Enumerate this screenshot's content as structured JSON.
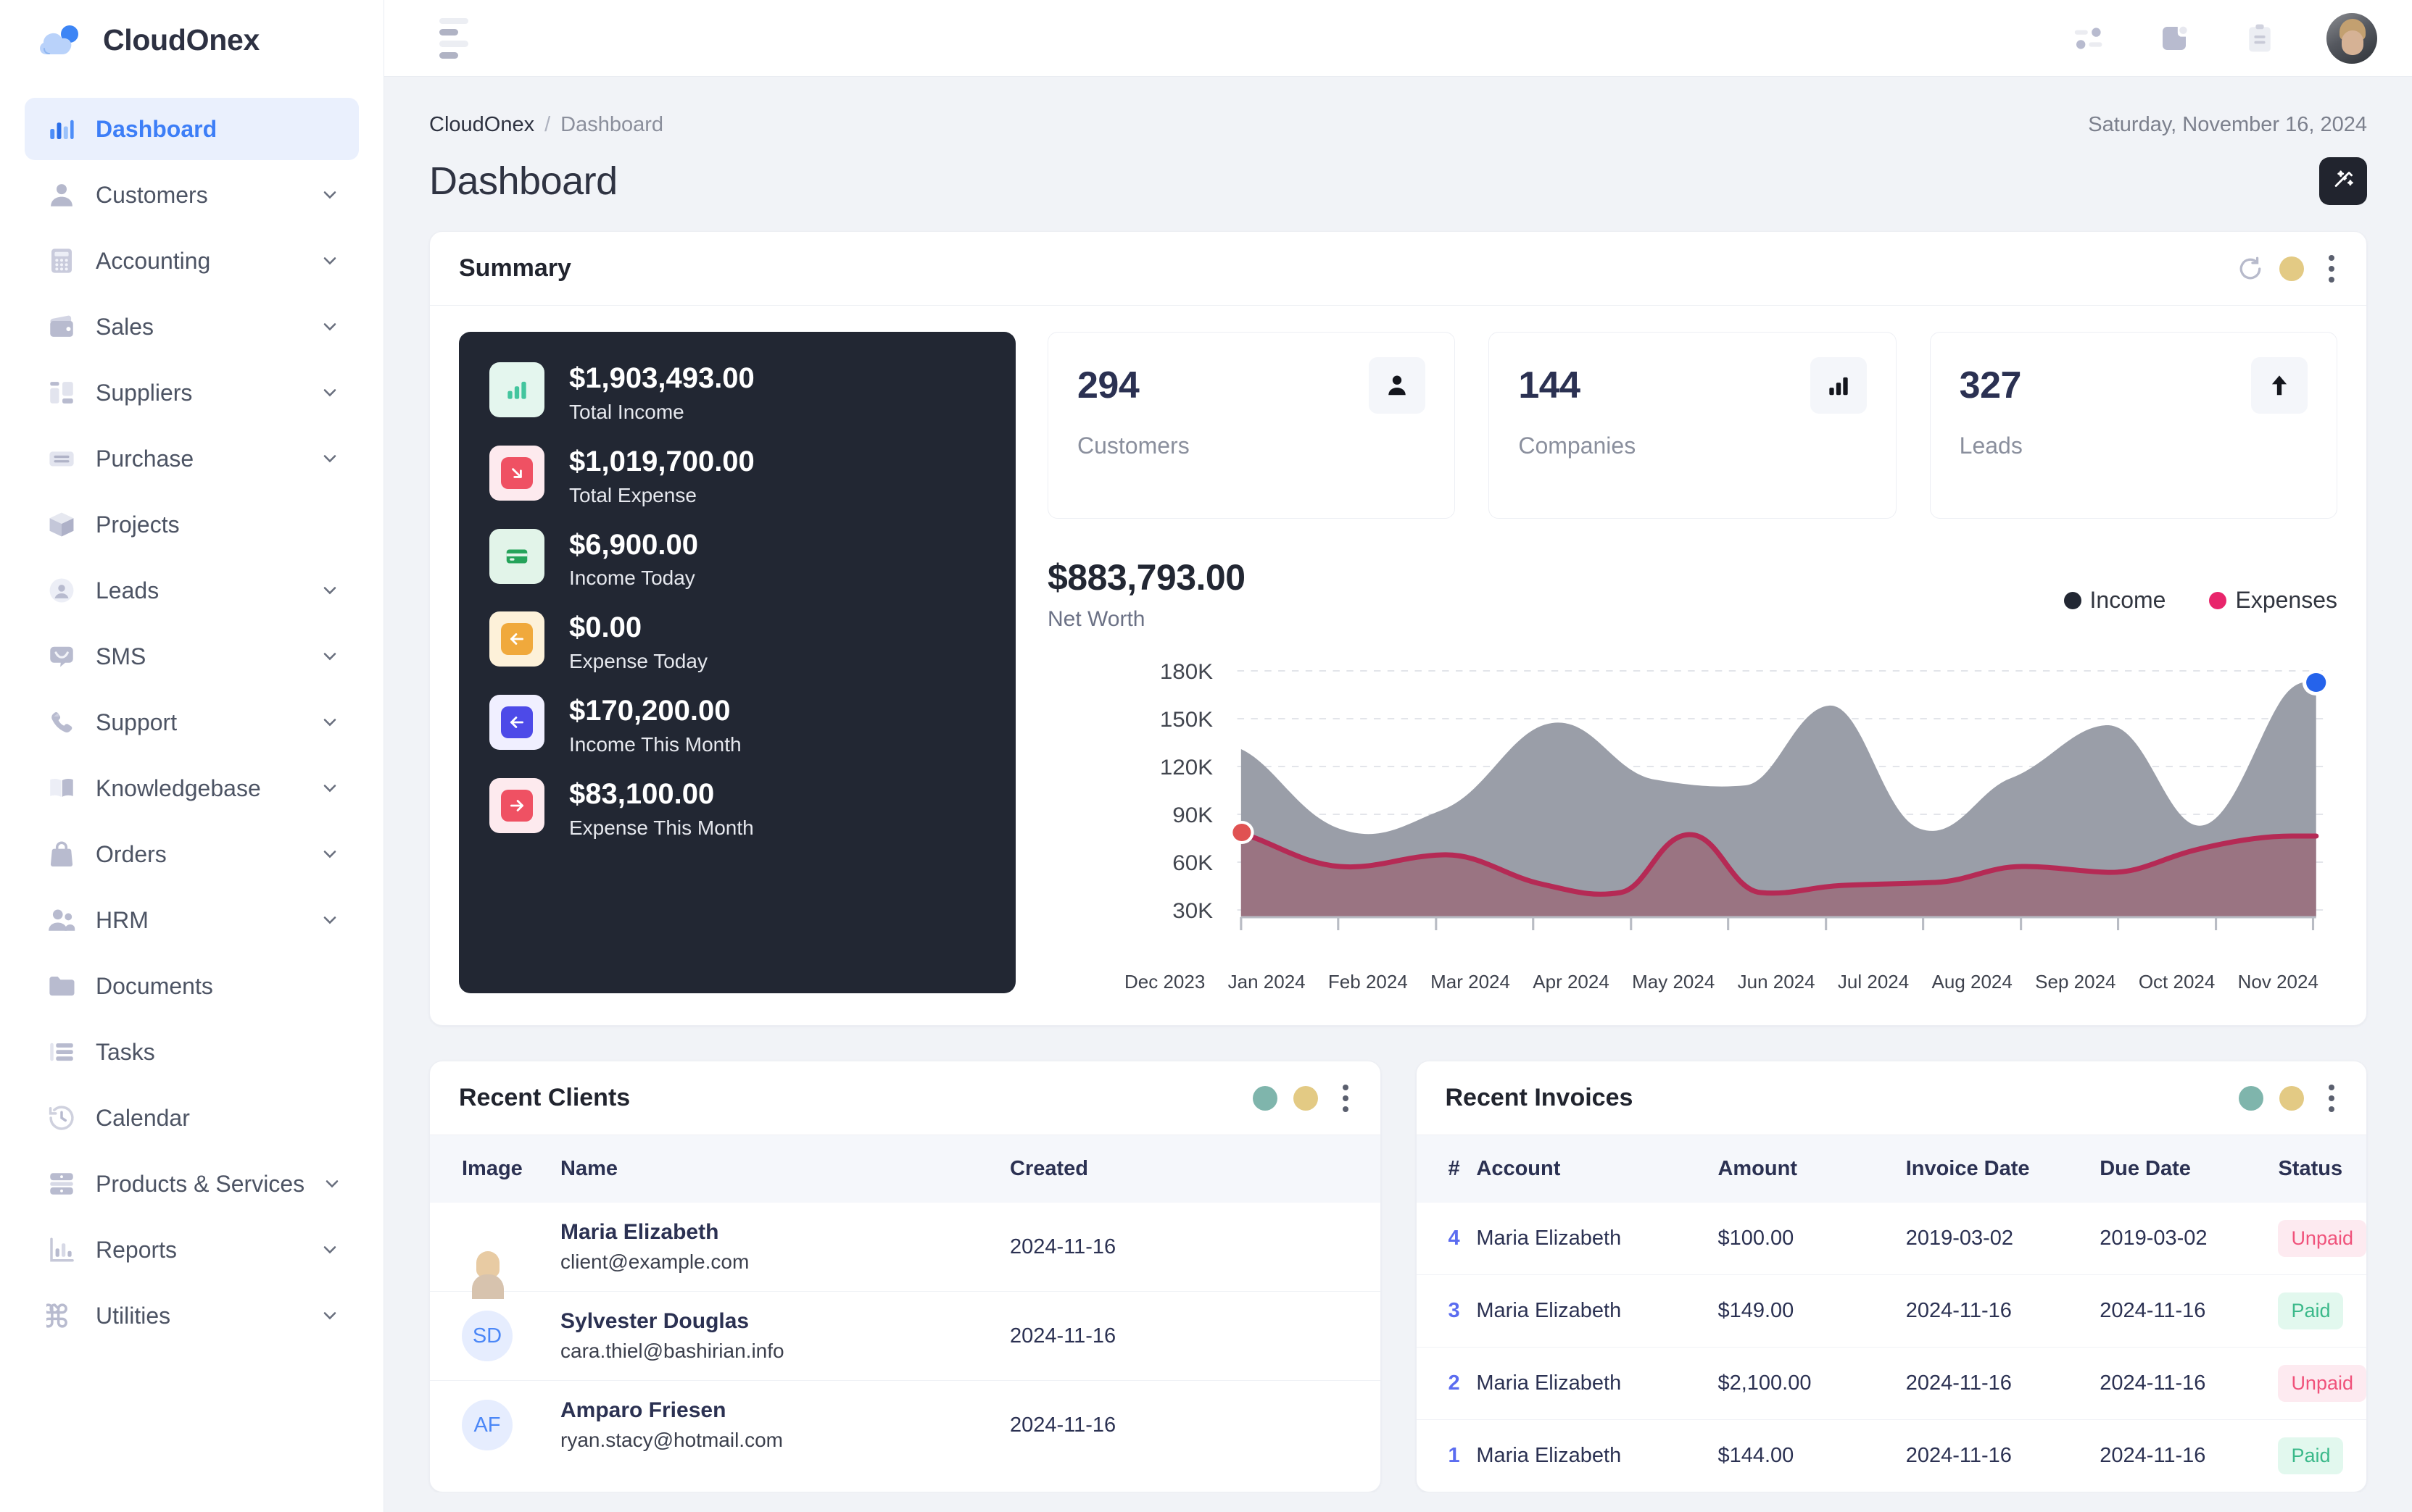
{
  "brand": {
    "name": "CloudOnex"
  },
  "sidebar": {
    "items": [
      {
        "label": "Dashboard",
        "icon": "bar-chart-icon",
        "active": true,
        "caret": false
      },
      {
        "label": "Customers",
        "icon": "user-icon",
        "active": false,
        "caret": true
      },
      {
        "label": "Accounting",
        "icon": "calculator-icon",
        "active": false,
        "caret": true
      },
      {
        "label": "Sales",
        "icon": "wallet-icon",
        "active": false,
        "caret": true
      },
      {
        "label": "Suppliers",
        "icon": "layout-icon",
        "active": false,
        "caret": true
      },
      {
        "label": "Purchase",
        "icon": "inbox-icon",
        "active": false,
        "caret": true
      },
      {
        "label": "Projects",
        "icon": "box-icon",
        "active": false,
        "caret": false
      },
      {
        "label": "Leads",
        "icon": "user-circle-icon",
        "active": false,
        "caret": true
      },
      {
        "label": "SMS",
        "icon": "message-icon",
        "active": false,
        "caret": true
      },
      {
        "label": "Support",
        "icon": "phone-icon",
        "active": false,
        "caret": true
      },
      {
        "label": "Knowledgebase",
        "icon": "book-icon",
        "active": false,
        "caret": true
      },
      {
        "label": "Orders",
        "icon": "bag-icon",
        "active": false,
        "caret": true
      },
      {
        "label": "HRM",
        "icon": "users-icon",
        "active": false,
        "caret": true
      },
      {
        "label": "Documents",
        "icon": "folder-icon",
        "active": false,
        "caret": false
      },
      {
        "label": "Tasks",
        "icon": "list-icon",
        "active": false,
        "caret": false
      },
      {
        "label": "Calendar",
        "icon": "clock-history-icon",
        "active": false,
        "caret": false
      },
      {
        "label": "Products & Services",
        "icon": "server-icon",
        "active": false,
        "caret": true
      },
      {
        "label": "Reports",
        "icon": "chart-bar-icon",
        "active": false,
        "caret": true
      },
      {
        "label": "Utilities",
        "icon": "command-icon",
        "active": false,
        "caret": true
      }
    ]
  },
  "topbar": {
    "menu_toggle": "hamburger-icon",
    "icons": [
      "sliders-icon",
      "note-icon",
      "clipboard-icon"
    ],
    "avatar": "user-avatar"
  },
  "breadcrumb": {
    "root": "CloudOnex",
    "separator": "/",
    "current": "Dashboard"
  },
  "header": {
    "title": "Dashboard",
    "date": "Saturday, November 16, 2024",
    "action_icon": "magic-wand-icon"
  },
  "summary": {
    "title": "Summary",
    "finance": [
      {
        "value": "$1,903,493.00",
        "label": "Total Income",
        "icon": "bar-chart-icon",
        "bg": "#e4f6ee",
        "fg": "#43c59e"
      },
      {
        "value": "$1,019,700.00",
        "label": "Total Expense",
        "icon": "arrow-down-right-icon",
        "bg": "#fdeaee",
        "fg": "#ef5163"
      },
      {
        "value": "$6,900.00",
        "label": "Income Today",
        "icon": "card-icon",
        "bg": "#e2f4e9",
        "fg": "#25a35a"
      },
      {
        "value": "$0.00",
        "label": "Expense Today",
        "icon": "arrow-left-icon",
        "bg": "#fdf1d9",
        "fg": "#f0a93c"
      },
      {
        "value": "$170,200.00",
        "label": "Income This Month",
        "icon": "arrow-left-icon",
        "bg": "#f0efff",
        "fg": "#4d4ae8"
      },
      {
        "value": "$83,100.00",
        "label": "Expense This Month",
        "icon": "arrow-right-icon",
        "bg": "#fdeaee",
        "fg": "#ef5163"
      }
    ],
    "stats": [
      {
        "value": "294",
        "label": "Customers",
        "icon": "person-icon"
      },
      {
        "value": "144",
        "label": "Companies",
        "icon": "bar-chart-icon"
      },
      {
        "value": "327",
        "label": "Leads",
        "icon": "arrow-up-icon"
      }
    ],
    "net_worth": {
      "value": "$883,793.00",
      "label": "Net Worth"
    }
  },
  "chart_data": {
    "type": "area",
    "title": "Net Worth",
    "xlabel": "",
    "ylabel": "",
    "grid": true,
    "legend_position": "top-right",
    "legend": [
      {
        "name": "Income",
        "color": "#222733"
      },
      {
        "name": "Expenses",
        "color": "#e8256b"
      }
    ],
    "categories": [
      "Dec 2023",
      "Jan 2024",
      "Feb 2024",
      "Mar 2024",
      "Apr 2024",
      "May 2024",
      "Jun 2024",
      "Jul 2024",
      "Aug 2024",
      "Sep 2024",
      "Oct 2024",
      "Nov 2024"
    ],
    "ytick_labels": [
      "30K",
      "60K",
      "90K",
      "120K",
      "150K",
      "180K"
    ],
    "ylim": [
      30000,
      180000
    ],
    "series": [
      {
        "name": "Income",
        "color": "#9a9ea8",
        "values": [
          132000,
          96000,
          104000,
          142000,
          124000,
          121000,
          148000,
          94000,
          117000,
          141000,
          91000,
          166000
        ]
      },
      {
        "name": "Expenses",
        "color": "#b52a55",
        "values": [
          84000,
          62000,
          70000,
          62000,
          46000,
          83000,
          43000,
          48000,
          48000,
          60000,
          57000,
          81000
        ]
      }
    ],
    "markers": [
      {
        "series": "Expenses",
        "x": "Dec 2023",
        "y": 84000,
        "color": "#e05252"
      },
      {
        "series": "Income",
        "x": "Nov 2024",
        "y": 166000,
        "color": "#2563eb"
      }
    ]
  },
  "recent_clients": {
    "title": "Recent Clients",
    "columns": [
      "Image",
      "Name",
      "Created"
    ],
    "rows": [
      {
        "avatar_type": "photo",
        "initials": "",
        "name": "Maria Elizabeth",
        "email": "client@example.com",
        "created": "2024-11-16"
      },
      {
        "avatar_type": "initials",
        "initials": "SD",
        "name": "Sylvester Douglas",
        "email": "cara.thiel@bashirian.info",
        "created": "2024-11-16"
      },
      {
        "avatar_type": "initials",
        "initials": "AF",
        "name": "Amparo Friesen",
        "email": "ryan.stacy@hotmail.com",
        "created": "2024-11-16"
      }
    ]
  },
  "recent_invoices": {
    "title": "Recent Invoices",
    "columns": [
      "#",
      "Account",
      "Amount",
      "Invoice Date",
      "Due Date",
      "Status"
    ],
    "rows": [
      {
        "id": "4",
        "account": "Maria Elizabeth",
        "amount": "$100.00",
        "invoice_date": "2019-03-02",
        "due_date": "2019-03-02",
        "status": "Unpaid"
      },
      {
        "id": "3",
        "account": "Maria Elizabeth",
        "amount": "$149.00",
        "invoice_date": "2024-11-16",
        "due_date": "2024-11-16",
        "status": "Paid"
      },
      {
        "id": "2",
        "account": "Maria Elizabeth",
        "amount": "$2,100.00",
        "invoice_date": "2024-11-16",
        "due_date": "2024-11-16",
        "status": "Unpaid"
      },
      {
        "id": "1",
        "account": "Maria Elizabeth",
        "amount": "$144.00",
        "invoice_date": "2024-11-16",
        "due_date": "2024-11-16",
        "status": "Paid"
      }
    ]
  },
  "colors": {
    "accent": "#3d7ef7",
    "dark_panel": "#222733",
    "paid": "#3bb98a",
    "unpaid": "#f0527b",
    "income_area": "#9a9ea8",
    "expense_area": "#b52a55"
  }
}
